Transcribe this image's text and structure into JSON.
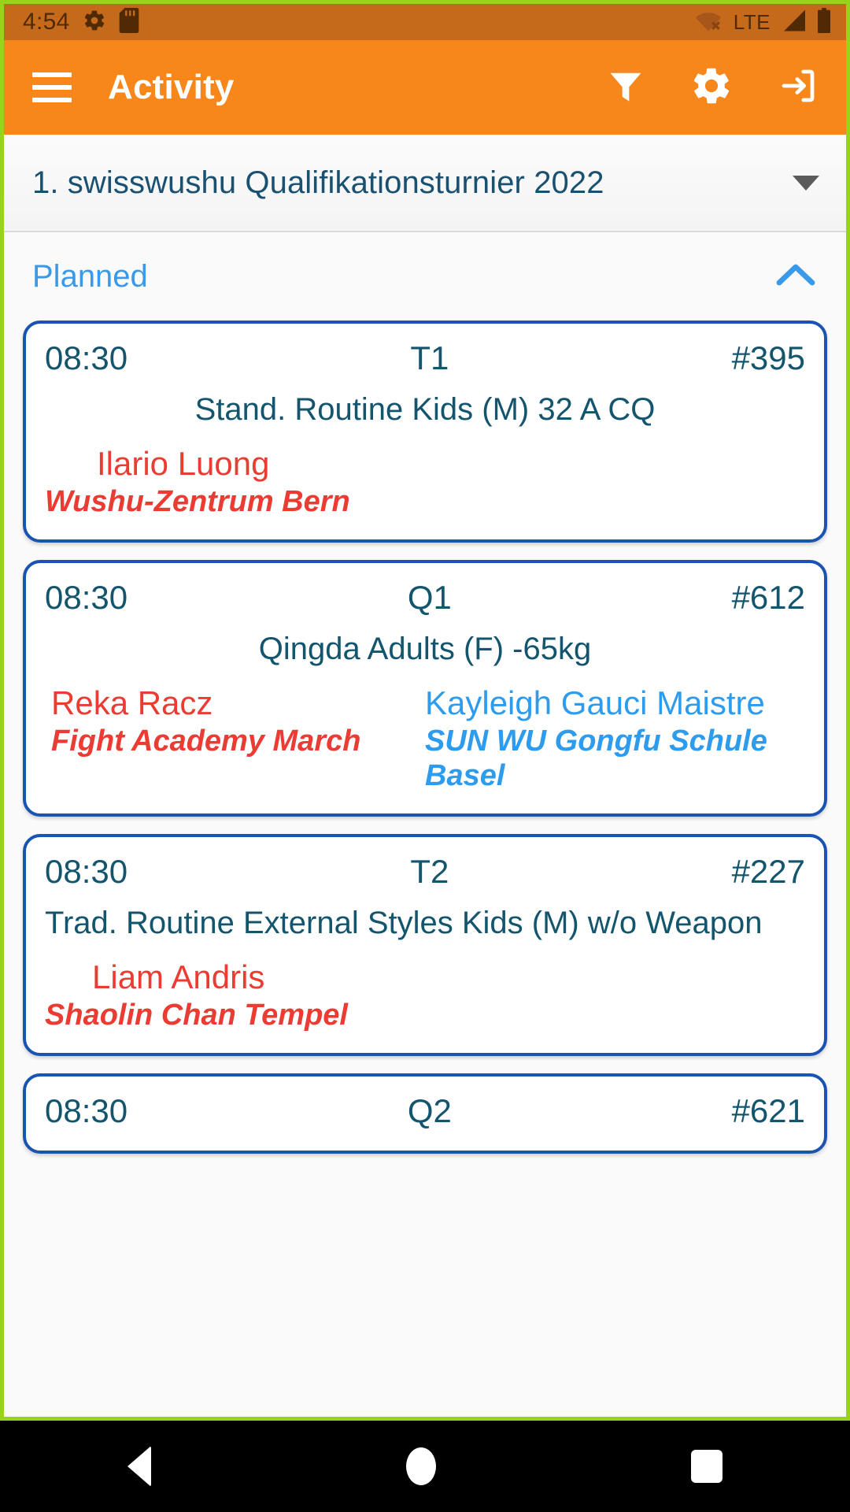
{
  "status_bar": {
    "clock": "4:54",
    "lte_label": "LTE",
    "icons": [
      "gear-icon",
      "sd-card-icon",
      "wifi-off-icon",
      "cellular-signal-icon",
      "battery-full-icon"
    ]
  },
  "app_bar": {
    "menu_icon": "hamburger-menu-icon",
    "title": "Activity",
    "actions": [
      {
        "name": "filter-icon",
        "label": "Filter"
      },
      {
        "name": "gear-icon",
        "label": "Settings"
      },
      {
        "name": "login-icon",
        "label": "Login"
      }
    ]
  },
  "tournament": {
    "selected": "1. swisswushu Qualifikationsturnier 2022",
    "caret_icon": "chevron-down-icon"
  },
  "section": {
    "title": "Planned",
    "chevron_icon": "chevron-up-icon",
    "expanded": true
  },
  "colors": {
    "app_bar": "#f7861b",
    "status_bar": "#c5691a",
    "card_border": "#1a54b0",
    "heading_text": "#14556e",
    "red_competitor": "#ea3c32",
    "blue_competitor": "#2d9bee",
    "section_title": "#3b9ae8",
    "record_frame": "#96d31a"
  },
  "cards": [
    {
      "time": "08:30",
      "area": "T1",
      "number": "#395",
      "discipline": "Stand. Routine Kids (M) 32 A CQ",
      "discipline_align": "center",
      "competitors": [
        {
          "side": "red",
          "name": "Ilario Luong",
          "club": "Wushu-Zentrum Bern"
        }
      ]
    },
    {
      "time": "08:30",
      "area": "Q1",
      "number": "#612",
      "discipline": "Qingda Adults (F) -65kg",
      "discipline_align": "center",
      "competitors": [
        {
          "side": "red",
          "name": "Reka Racz",
          "club": "Fight Academy March"
        },
        {
          "side": "blue",
          "name": "Kayleigh Gauci Maistre",
          "club": "SUN WU Gongfu Schule Basel"
        }
      ]
    },
    {
      "time": "08:30",
      "area": "T2",
      "number": "#227",
      "discipline": "Trad. Routine External Styles Kids (M) w/o Weapon",
      "discipline_align": "left",
      "competitors": [
        {
          "side": "red",
          "name": "Liam  Andris",
          "club": "Shaolin Chan Tempel"
        }
      ]
    },
    {
      "time": "08:30",
      "area": "Q2",
      "number": "#621",
      "discipline": "",
      "discipline_align": "center",
      "competitors": []
    }
  ],
  "nav_bar": {
    "back": "back-triangle-icon",
    "home": "home-circle-icon",
    "recents": "recents-square-icon"
  }
}
